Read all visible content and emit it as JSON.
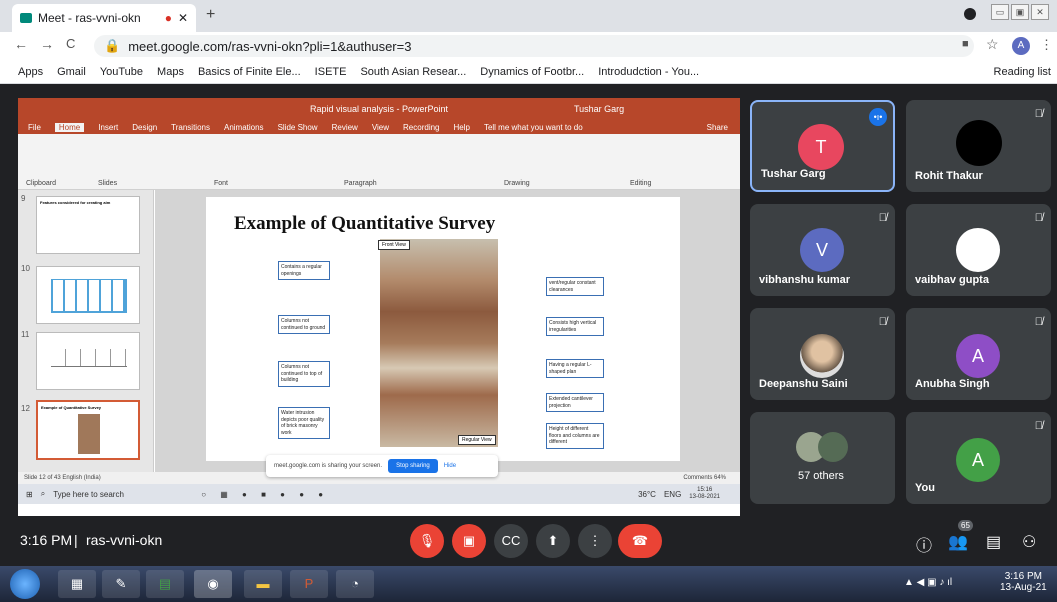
{
  "browser": {
    "tab_title": "Meet - ras-vvni-okn",
    "url": "meet.google.com/ras-vvni-okn?pli=1&authuser=3",
    "profile": "A",
    "bookmarks": [
      "Apps",
      "Gmail",
      "YouTube",
      "Maps",
      "Basics of Finite Ele...",
      "ISETE",
      "South Asian Resear...",
      "Dynamics of Footbr...",
      "Introdudction - You..."
    ],
    "reading_list": "Reading list"
  },
  "ppt": {
    "title": "Rapid visual analysis - PowerPoint",
    "user": "Tushar Garg",
    "menu": [
      "File",
      "Home",
      "Insert",
      "Design",
      "Transitions",
      "Animations",
      "Slide Show",
      "Review",
      "View",
      "Recording",
      "Help",
      "Tell me what you want to do",
      "Share"
    ],
    "ribbon_groups": [
      "Clipboard",
      "Slides",
      "Font",
      "Paragraph",
      "Drawing",
      "Editing"
    ],
    "thumb_numbers": [
      "9",
      "10",
      "11",
      "12"
    ],
    "thumb9_title": "Features considered for creating aim",
    "thumb12_title": "Example of Quantitative Survey",
    "slide_title": "Example of Quantitative Survey",
    "front_view": "Front View",
    "regular_view": "Regular View",
    "boxes": [
      "Contains a regular openings",
      "Columns not continued to ground",
      "Columns not continued to top of building",
      "Water intrusion depicts poor quality of brick masonry work",
      "vent/regular constant clearances",
      "Consists high vertical irregularities",
      "Having a regular L-shaped plan",
      "Extended cantilever projection",
      "Height of different floors and columns are different"
    ],
    "status": "Slide 12 of 43   English (India)",
    "status_right": "Comments   64%",
    "share_msg": "meet.google.com is sharing your screen.",
    "stop": "Stop sharing",
    "hide": "Hide",
    "search": "Type here to search",
    "temp": "36°C",
    "lang": "ENG",
    "time": "15:16",
    "date": "13-08-2021"
  },
  "participants": [
    {
      "name": "Tushar Garg",
      "initial": "T",
      "color": "#e8475f"
    },
    {
      "name": "Rohit Thakur",
      "initial": "",
      "color": "#000000"
    },
    {
      "name": "vibhanshu kumar",
      "initial": "V",
      "color": "#5c6bc0"
    },
    {
      "name": "vaibhav gupta",
      "initial": "",
      "color": "#ffffff"
    },
    {
      "name": "Deepanshu Saini",
      "initial": "",
      "color": "#c9a88a"
    },
    {
      "name": "Anubha Singh",
      "initial": "A",
      "color": "#8e4ec6"
    },
    {
      "name": "57 others",
      "initial": "",
      "color": "#556b55"
    },
    {
      "name": "You",
      "initial": "A",
      "color": "#43a047"
    }
  ],
  "meeting": {
    "time": "3:16 PM",
    "code": "ras-vvni-okn",
    "people_count": "65"
  },
  "taskbar": {
    "time": "3:16 PM",
    "date": "13-Aug-21"
  }
}
